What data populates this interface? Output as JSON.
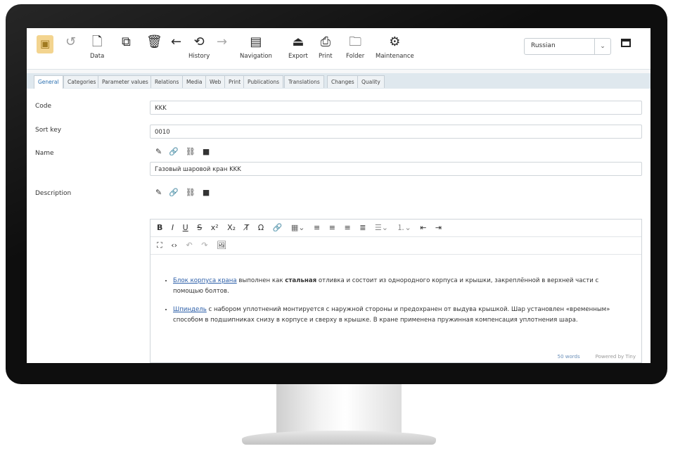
{
  "toolbar": {
    "items": [
      {
        "icon": "box-icon",
        "label": ""
      },
      {
        "icon": "undo-icon",
        "label": ""
      },
      {
        "icon": "file-icon",
        "label": "Data"
      },
      {
        "icon": "copy-icon",
        "label": ""
      },
      {
        "icon": "trash-icon",
        "label": ""
      },
      {
        "icon": "back-arrow-icon",
        "label": ""
      },
      {
        "icon": "history-icon",
        "label": "History"
      },
      {
        "icon": "forward-arrow-icon",
        "label": ""
      },
      {
        "icon": "navigation-icon",
        "label": "Navigation"
      },
      {
        "icon": "export-icon",
        "label": "Export"
      },
      {
        "icon": "print-icon",
        "label": "Print"
      },
      {
        "icon": "folder-icon",
        "label": "Folder"
      },
      {
        "icon": "maintenance-icon",
        "label": "Maintenance"
      }
    ],
    "language": "Russian"
  },
  "tabs": [
    "General",
    "Categories",
    "Parameter values",
    "Relations",
    "Media",
    "Web",
    "Print",
    "Publications",
    "Translations",
    "Changes",
    "Quality"
  ],
  "form": {
    "code_label": "Code",
    "code_value": "KKK",
    "sort_label": "Sort key",
    "sort_value": "0010",
    "name_label": "Name",
    "name_value": "Газовый шаровой кран KKK",
    "desc_label": "Description"
  },
  "editor": {
    "item1_link": "Блок корпуса крана",
    "item1_text_a": " выполнен как ",
    "item1_bold": "стальная",
    "item1_text_b": " отливка и состоит из однородного корпуса и крышки, закреплённой в верхней части с помощью болтов.",
    "item2_link": "Шпиндель",
    "item2_text": " с набором уплотнений монтируется с наружной стороны и предохранен от выдува крышкой. Шар установлен «временным» способом в подшипниках снизу в корпусе и сверху в крышке. В кране применена пружинная компенсация уплотнения шара.",
    "word_count": "50 words",
    "powered_by": "Powered by Tiny"
  },
  "colors": {
    "accent": "#2a6fb0",
    "selected": "#f3d48f",
    "tabbar": "#dfe8ee"
  }
}
